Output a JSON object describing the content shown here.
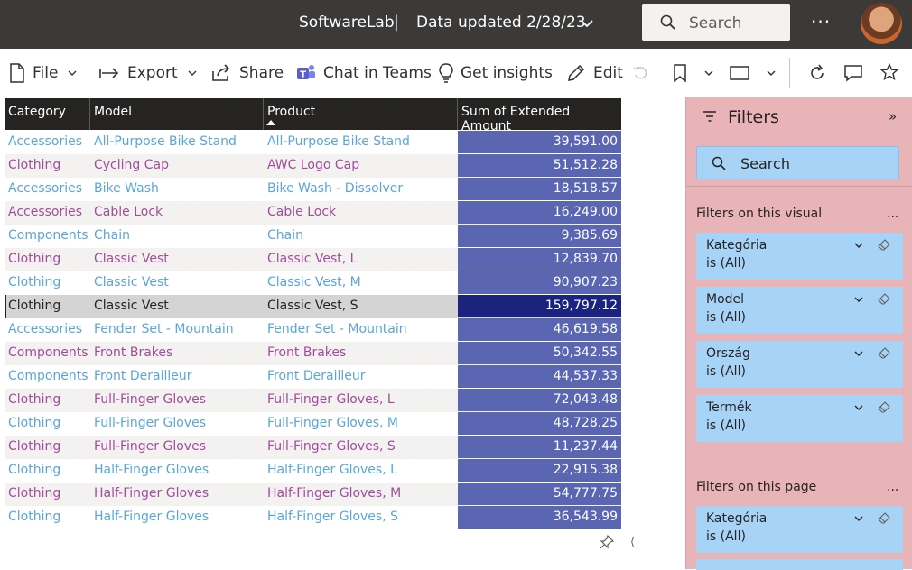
{
  "topbar": {
    "workspace": "SoftwareLab",
    "separator": "|",
    "updated": "Data updated 2/28/23",
    "search_placeholder": "Search",
    "more": "···"
  },
  "commands": {
    "file": "File",
    "export": "Export",
    "share": "Share",
    "chat": "Chat in Teams",
    "insights": "Get insights",
    "edit": "Edit"
  },
  "table": {
    "headers": [
      "Category",
      "Model",
      "Product",
      "Sum of Extended Amount"
    ],
    "rows": [
      {
        "category": "Accessories",
        "model": "All-Purpose Bike Stand",
        "product": "All-Purpose Bike Stand",
        "amount": "39,591.00",
        "color": "#5aa6d8"
      },
      {
        "category": "Clothing",
        "model": "Cycling Cap",
        "product": "AWC Logo Cap",
        "amount": "51,512.28",
        "color": "#a24c9c"
      },
      {
        "category": "Accessories",
        "model": "Bike Wash",
        "product": "Bike Wash - Dissolver",
        "amount": "18,518.57",
        "color": "#5aa6d8"
      },
      {
        "category": "Accessories",
        "model": "Cable Lock",
        "product": "Cable Lock",
        "amount": "16,249.00",
        "color": "#a24c9c"
      },
      {
        "category": "Components",
        "model": "Chain",
        "product": "Chain",
        "amount": "9,385.69",
        "color": "#5aa6d8"
      },
      {
        "category": "Clothing",
        "model": "Classic Vest",
        "product": "Classic Vest, L",
        "amount": "12,839.70",
        "color": "#a24c9c"
      },
      {
        "category": "Clothing",
        "model": "Classic Vest",
        "product": "Classic Vest, M",
        "amount": "90,907.23",
        "color": "#5aa6d8"
      },
      {
        "category": "Clothing",
        "model": "Classic Vest",
        "product": "Classic Vest, S",
        "amount": "159,797.12",
        "color": "#252423"
      },
      {
        "category": "Accessories",
        "model": "Fender Set - Mountain",
        "product": "Fender Set - Mountain",
        "amount": "46,619.58",
        "color": "#5aa6d8"
      },
      {
        "category": "Components",
        "model": "Front Brakes",
        "product": "Front Brakes",
        "amount": "50,342.55",
        "color": "#a24c9c"
      },
      {
        "category": "Components",
        "model": "Front Derailleur",
        "product": "Front Derailleur",
        "amount": "44,537.33",
        "color": "#5aa6d8"
      },
      {
        "category": "Clothing",
        "model": "Full-Finger Gloves",
        "product": "Full-Finger Gloves, L",
        "amount": "72,043.48",
        "color": "#a24c9c"
      },
      {
        "category": "Clothing",
        "model": "Full-Finger Gloves",
        "product": "Full-Finger Gloves, M",
        "amount": "48,728.25",
        "color": "#5aa6d8"
      },
      {
        "category": "Clothing",
        "model": "Full-Finger Gloves",
        "product": "Full-Finger Gloves, S",
        "amount": "11,237.44",
        "color": "#a24c9c"
      },
      {
        "category": "Clothing",
        "model": "Half-Finger Gloves",
        "product": "Half-Finger Gloves, L",
        "amount": "22,915.38",
        "color": "#5aa6d8"
      },
      {
        "category": "Clothing",
        "model": "Half-Finger Gloves",
        "product": "Half-Finger Gloves, M",
        "amount": "54,777.75",
        "color": "#a24c9c"
      },
      {
        "category": "Clothing",
        "model": "Half-Finger Gloves",
        "product": "Half-Finger Gloves, S",
        "amount": "36,543.99",
        "color": "#5aa6d8"
      }
    ],
    "selected_index": 7
  },
  "filters": {
    "title": "Filters",
    "search_placeholder": "Search",
    "visual_section": "Filters on this visual",
    "page_section": "Filters on this page",
    "section_more": "...",
    "visual_filters": [
      {
        "name": "Kategória",
        "value": "is (All)"
      },
      {
        "name": "Model",
        "value": "is (All)"
      },
      {
        "name": "Ország",
        "value": "is (All)"
      },
      {
        "name": "Termék",
        "value": "is (All)"
      }
    ],
    "page_filters": [
      {
        "name": "Kategória",
        "value": "is (All)"
      }
    ]
  },
  "colors": {
    "accent_blue": "#5aa6d8",
    "accent_purple": "#a24c9c",
    "bar_fill": "#5b66b3",
    "bar_selected": "#1a237e",
    "filter_pane": "#e8b4b8",
    "filter_card": "#a7d3f7"
  }
}
